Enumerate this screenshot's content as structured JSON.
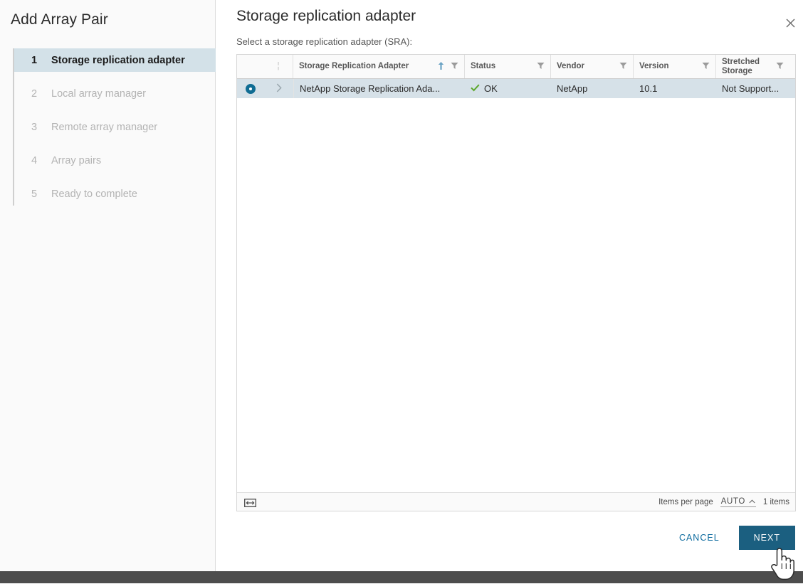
{
  "wizard": {
    "title": "Add Array Pair",
    "steps": [
      {
        "num": "1",
        "label": "Storage replication adapter",
        "state": "active"
      },
      {
        "num": "2",
        "label": "Local array manager",
        "state": "inactive"
      },
      {
        "num": "3",
        "label": "Remote array manager",
        "state": "inactive"
      },
      {
        "num": "4",
        "label": "Array pairs",
        "state": "inactive"
      },
      {
        "num": "5",
        "label": "Ready to complete",
        "state": "inactive"
      }
    ]
  },
  "panel": {
    "title": "Storage replication adapter",
    "subtitle": "Select a storage replication adapter (SRA):",
    "close_icon": "close-icon"
  },
  "grid": {
    "columns": [
      {
        "key": "select",
        "label": "",
        "icon": ""
      },
      {
        "key": "expand",
        "label": "¦",
        "icon": ""
      },
      {
        "key": "name",
        "label": "Storage Replication Adapter",
        "sort": "ascending",
        "sort_icon": "sort-asc-icon",
        "filter_icon": "filter-icon"
      },
      {
        "key": "status",
        "label": "Status",
        "filter_icon": "filter-icon"
      },
      {
        "key": "vendor",
        "label": "Vendor",
        "filter_icon": "filter-icon"
      },
      {
        "key": "version",
        "label": "Version",
        "filter_icon": "filter-icon"
      },
      {
        "key": "stretched",
        "label": "Stretched Storage",
        "filter_icon": "filter-icon"
      }
    ],
    "rows": [
      {
        "selected": true,
        "name": "NetApp Storage Replication Ada...",
        "status": "OK",
        "status_icon": "check-icon",
        "vendor": "NetApp",
        "version": "10.1",
        "stretched": "Not Support..."
      }
    ],
    "footer": {
      "fit_icon": "fit-columns-icon",
      "items_per_page_label": "Items per page",
      "items_per_page_value": "AUTO",
      "caret_icon": "chevron-up-icon",
      "items_count": "1 items"
    }
  },
  "actions": {
    "cancel_label": "CANCEL",
    "next_label": "NEXT"
  },
  "colors": {
    "accent": "#1b5f80",
    "link": "#0b6a9e",
    "row_selected": "#d6e1e8",
    "step_active_bg": "#d3e1e8",
    "status_ok": "#5ba72b",
    "radio": "#0f6c93",
    "bottom_bar": "#4d4d4d"
  }
}
